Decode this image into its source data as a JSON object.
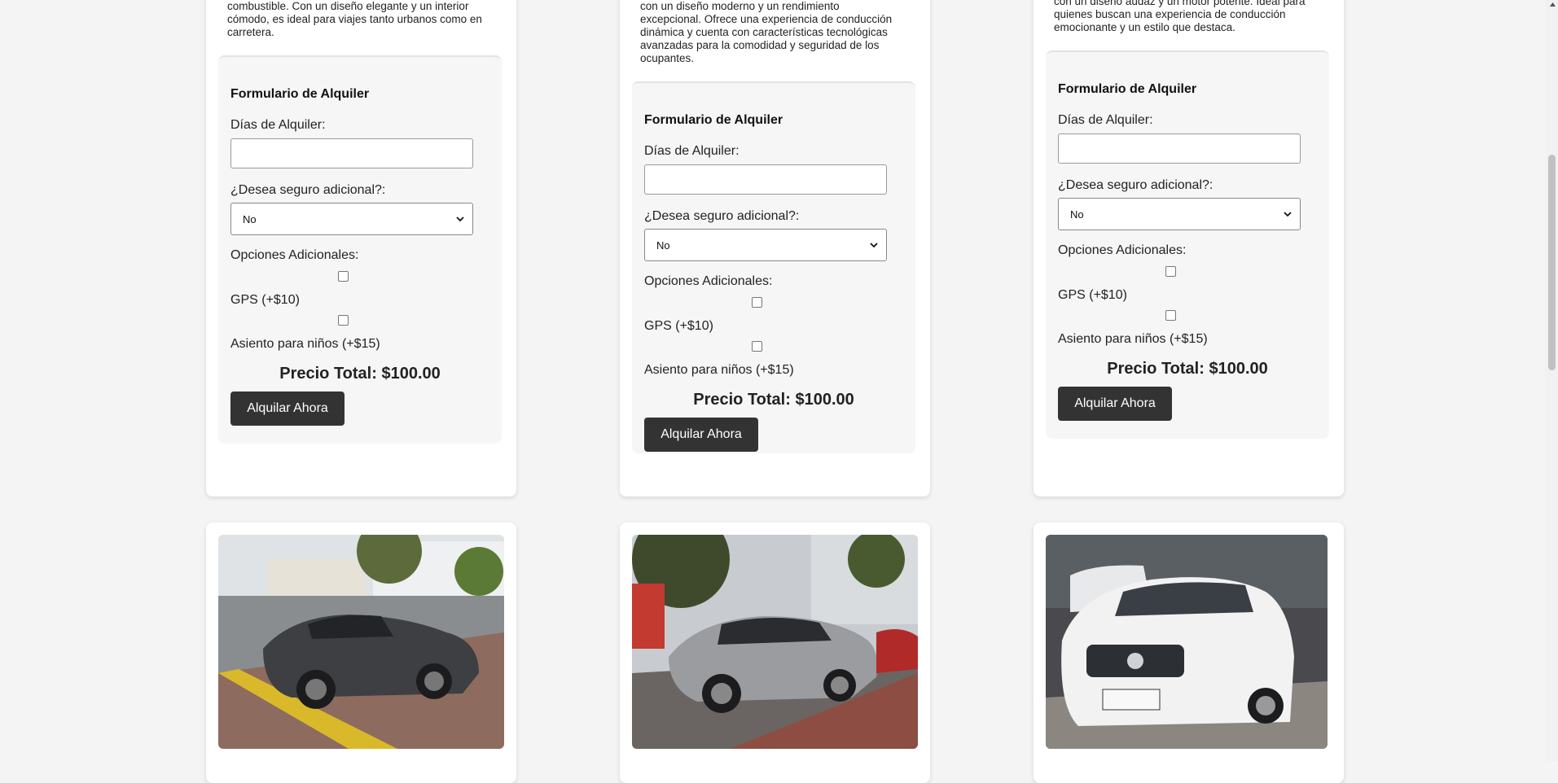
{
  "cards": [
    {
      "description": [
        "combustible. Con un diseño elegante y un interior",
        "cómodo, es ideal para viajes tanto urbanos como en",
        "carretera."
      ],
      "form": {
        "title": "Formulario de Alquiler",
        "days_label": "Días de Alquiler:",
        "days_value": "",
        "insurance_label": "¿Desea seguro adicional?:",
        "insurance_selected": "No",
        "options_label": "Opciones Adicionales:",
        "gps_label": "GPS (+$10)",
        "child_seat_label": "Asiento para niños (+$15)",
        "total": "Precio Total: $100.00",
        "button": "Alquilar Ahora"
      }
    },
    {
      "description": [
        "con un diseño moderno y un rendimiento",
        "excepcional. Ofrece una experiencia de conducción",
        "dinámica y cuenta con características tecnológicas",
        "avanzadas para la comodidad y seguridad de los",
        "ocupantes."
      ],
      "form": {
        "title": "Formulario de Alquiler",
        "days_label": "Días de Alquiler:",
        "days_value": "",
        "insurance_label": "¿Desea seguro adicional?:",
        "insurance_selected": "No",
        "options_label": "Opciones Adicionales:",
        "gps_label": "GPS (+$10)",
        "child_seat_label": "Asiento para niños (+$15)",
        "total": "Precio Total: $100.00",
        "button": "Alquilar Ahora"
      }
    },
    {
      "description": [
        "con un diseño audaz y un motor potente. Ideal para",
        "quienes buscan una experiencia de conducción",
        "emocionante y un estilo que destaca."
      ],
      "form": {
        "title": "Formulario de Alquiler",
        "days_label": "Días de Alquiler:",
        "days_value": "",
        "insurance_label": "¿Desea seguro adicional?:",
        "insurance_selected": "No",
        "options_label": "Opciones Adicionales:",
        "gps_label": "GPS (+$10)",
        "child_seat_label": "Asiento para niños (+$15)",
        "total": "Precio Total: $100.00",
        "button": "Alquilar Ahora"
      }
    }
  ],
  "photos": [
    {
      "subject": "dark grey sports coupe parked on street"
    },
    {
      "subject": "silver hatchback parked on street"
    },
    {
      "subject": "white sedan parked in lot"
    }
  ],
  "colors": {
    "button_bg": "#333333",
    "page_bg": "#f4f4f4",
    "card_bg": "#ffffff",
    "form_bg": "#f6f6f6"
  }
}
